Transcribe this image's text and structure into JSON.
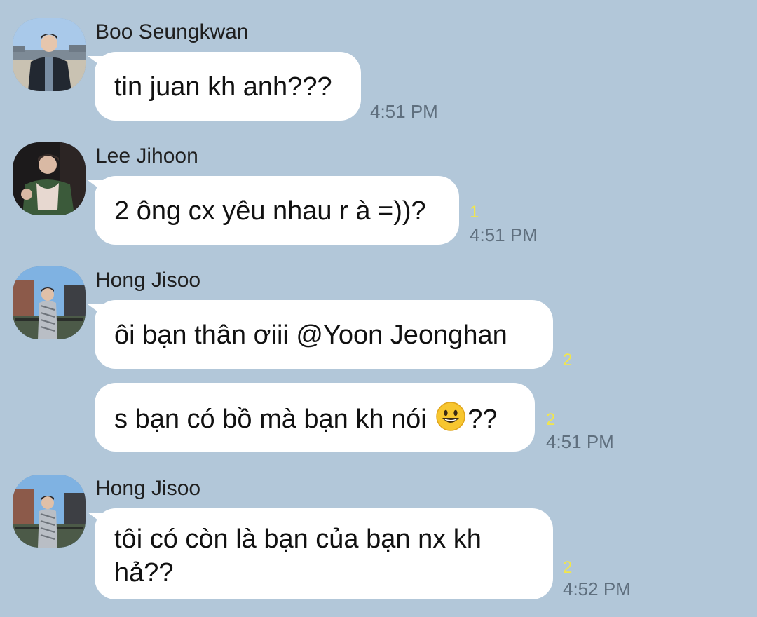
{
  "messages": [
    {
      "sender": "Boo Seungkwan",
      "avatar": "profile-photo-boo-seungkwan",
      "bubbles": [
        {
          "text": "tin juan kh anh???",
          "unread": "",
          "time": "4:51 PM"
        }
      ]
    },
    {
      "sender": "Lee Jihoon",
      "avatar": "profile-photo-lee-jihoon",
      "bubbles": [
        {
          "text": "2 ông cx yêu nhau r à =))?",
          "unread": "1",
          "time": "4:51 PM"
        }
      ]
    },
    {
      "sender": "Hong Jisoo",
      "avatar": "profile-photo-hong-jisoo",
      "bubbles": [
        {
          "text": "ôi bạn thân ơiii @Yoon Jeonghan",
          "unread": "2",
          "time": ""
        },
        {
          "text_before": "s bạn có bồ mà bạn kh nói ",
          "emoji": "grinning-face-emoji",
          "text_after": "??",
          "unread": "2",
          "time": "4:51 PM"
        }
      ]
    },
    {
      "sender": "Hong Jisoo",
      "avatar": "profile-photo-hong-jisoo",
      "bubbles": [
        {
          "line1": "tôi có còn là bạn của bạn nx kh",
          "line2": "hả??",
          "unread": "2",
          "time": "4:52 PM"
        }
      ]
    }
  ],
  "colors": {
    "background": "#b2c7d9",
    "bubble": "#ffffff",
    "unread": "#f2e64b",
    "time": "#5f6f7e"
  }
}
